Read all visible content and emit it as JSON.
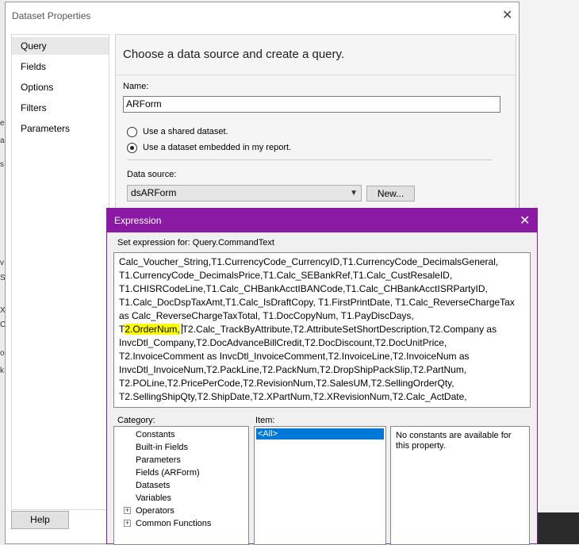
{
  "background_app": {
    "left_fragments": [
      "e",
      "a",
      "s",
      "v",
      "S",
      "X",
      "C",
      "o",
      "k"
    ]
  },
  "dataset_window": {
    "title": "Dataset Properties",
    "nav_items": [
      {
        "label": "Query",
        "selected": true
      },
      {
        "label": "Fields",
        "selected": false
      },
      {
        "label": "Options",
        "selected": false
      },
      {
        "label": "Filters",
        "selected": false
      },
      {
        "label": "Parameters",
        "selected": false
      }
    ],
    "heading": "Choose a data source and create a query.",
    "name_label": "Name:",
    "name_value": "ARForm",
    "radio_shared": "Use a shared dataset.",
    "radio_embedded": "Use a dataset embedded in my report.",
    "data_source_label": "Data source:",
    "data_source_value": "dsARForm",
    "new_button": "New...",
    "help_button": "Help"
  },
  "expression_dialog": {
    "title": "Expression",
    "set_expression_label": "Set expression for: Query.CommandText",
    "lines": [
      "Calc_Voucher_String,T1.CurrencyCode_CurrencyID,T1.CurrencyCode_DecimalsGeneral,",
      "T1.CurrencyCode_DecimalsPrice,T1.Calc_SEBankRef,T1.Calc_CustResaleID,",
      "T1.CHISRCodeLine,T1.Calc_CHBankAcctIBANCode,T1.Calc_CHBankAcctISRPartyID,",
      "T1.Calc_DocDspTaxAmt,T1.Calc_IsDraftCopy, T1.FirstPrintDate, T1.Calc_ReverseChargeTax",
      "as Calc_ReverseChargeTaxTotal, T1.DocCopyNum, T1.PayDiscDays,"
    ],
    "line6_prefix": "T",
    "line6_highlight": "2.OrderNum,",
    "line6_rest": "T2.Calc_TrackByAttribute,T2.AttributeSetShortDescription,T2.Company as",
    "lines_after": [
      "InvcDtl_Company,T2.DocAdvanceBillCredit,T2.DocDiscount,T2.DocUnitPrice,",
      "T2.InvoiceComment as InvcDtl_InvoiceComment,T2.InvoiceLine,T2.InvoiceNum as",
      "InvcDtl_InvoiceNum,T2.PackLine,T2.PackNum,T2.DropShipPackSlip,T2.PartNum,",
      "T2.POLine,T2.PricePerCode,T2.RevisionNum,T2.SalesUM,T2.SellingOrderQty,",
      "T2.SellingShipQty,T2.ShipDate,T2.XPartNum,T2.XRevisionNum,T2.Calc_ActDate,"
    ],
    "category_label": "Category:",
    "item_label": "Item:",
    "categories": [
      {
        "label": "Constants",
        "expandable": false
      },
      {
        "label": "Built-in Fields",
        "expandable": false
      },
      {
        "label": "Parameters",
        "expandable": false
      },
      {
        "label": "Fields (ARForm)",
        "expandable": false
      },
      {
        "label": "Datasets",
        "expandable": false
      },
      {
        "label": "Variables",
        "expandable": false
      },
      {
        "label": "Operators",
        "expandable": true
      },
      {
        "label": "Common Functions",
        "expandable": true
      }
    ],
    "items": [
      "<All>"
    ],
    "description": "No constants are available for this property."
  },
  "colors": {
    "expression_titlebar": "#8a1aa4",
    "selection": "#0078d7",
    "highlight": "#ffff00"
  }
}
